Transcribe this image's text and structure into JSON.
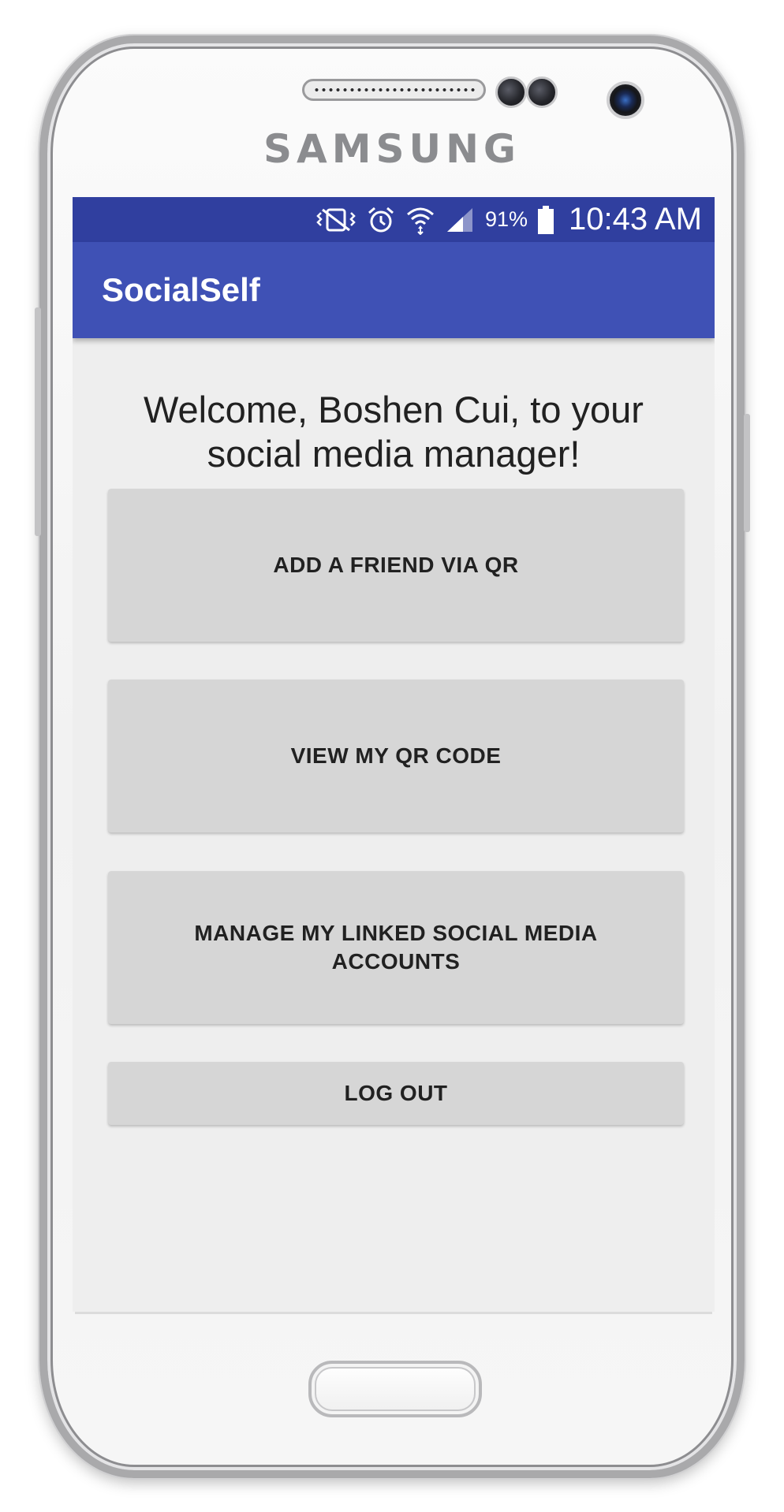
{
  "device": {
    "brand": "SAMSUNG"
  },
  "status_bar": {
    "battery_percent": "91%",
    "time": "10:43 AM",
    "icons": [
      "vibrate-mute-icon",
      "alarm-icon",
      "wifi-icon",
      "signal-icon",
      "battery-icon"
    ]
  },
  "app_bar": {
    "title": "SocialSelf"
  },
  "main": {
    "welcome_line1": "Welcome, Boshen Cui, to your",
    "welcome_line2": "social media manager!",
    "buttons": [
      {
        "label": "ADD A FRIEND VIA QR"
      },
      {
        "label": "VIEW MY QR CODE"
      },
      {
        "label": "MANAGE MY LINKED SOCIAL MEDIA ACCOUNTS"
      },
      {
        "label": "LOG OUT"
      }
    ]
  },
  "colors": {
    "primary": "#3f51b5",
    "primary_dark": "#303f9f",
    "background": "#eeeeee",
    "button": "#d6d6d6"
  }
}
